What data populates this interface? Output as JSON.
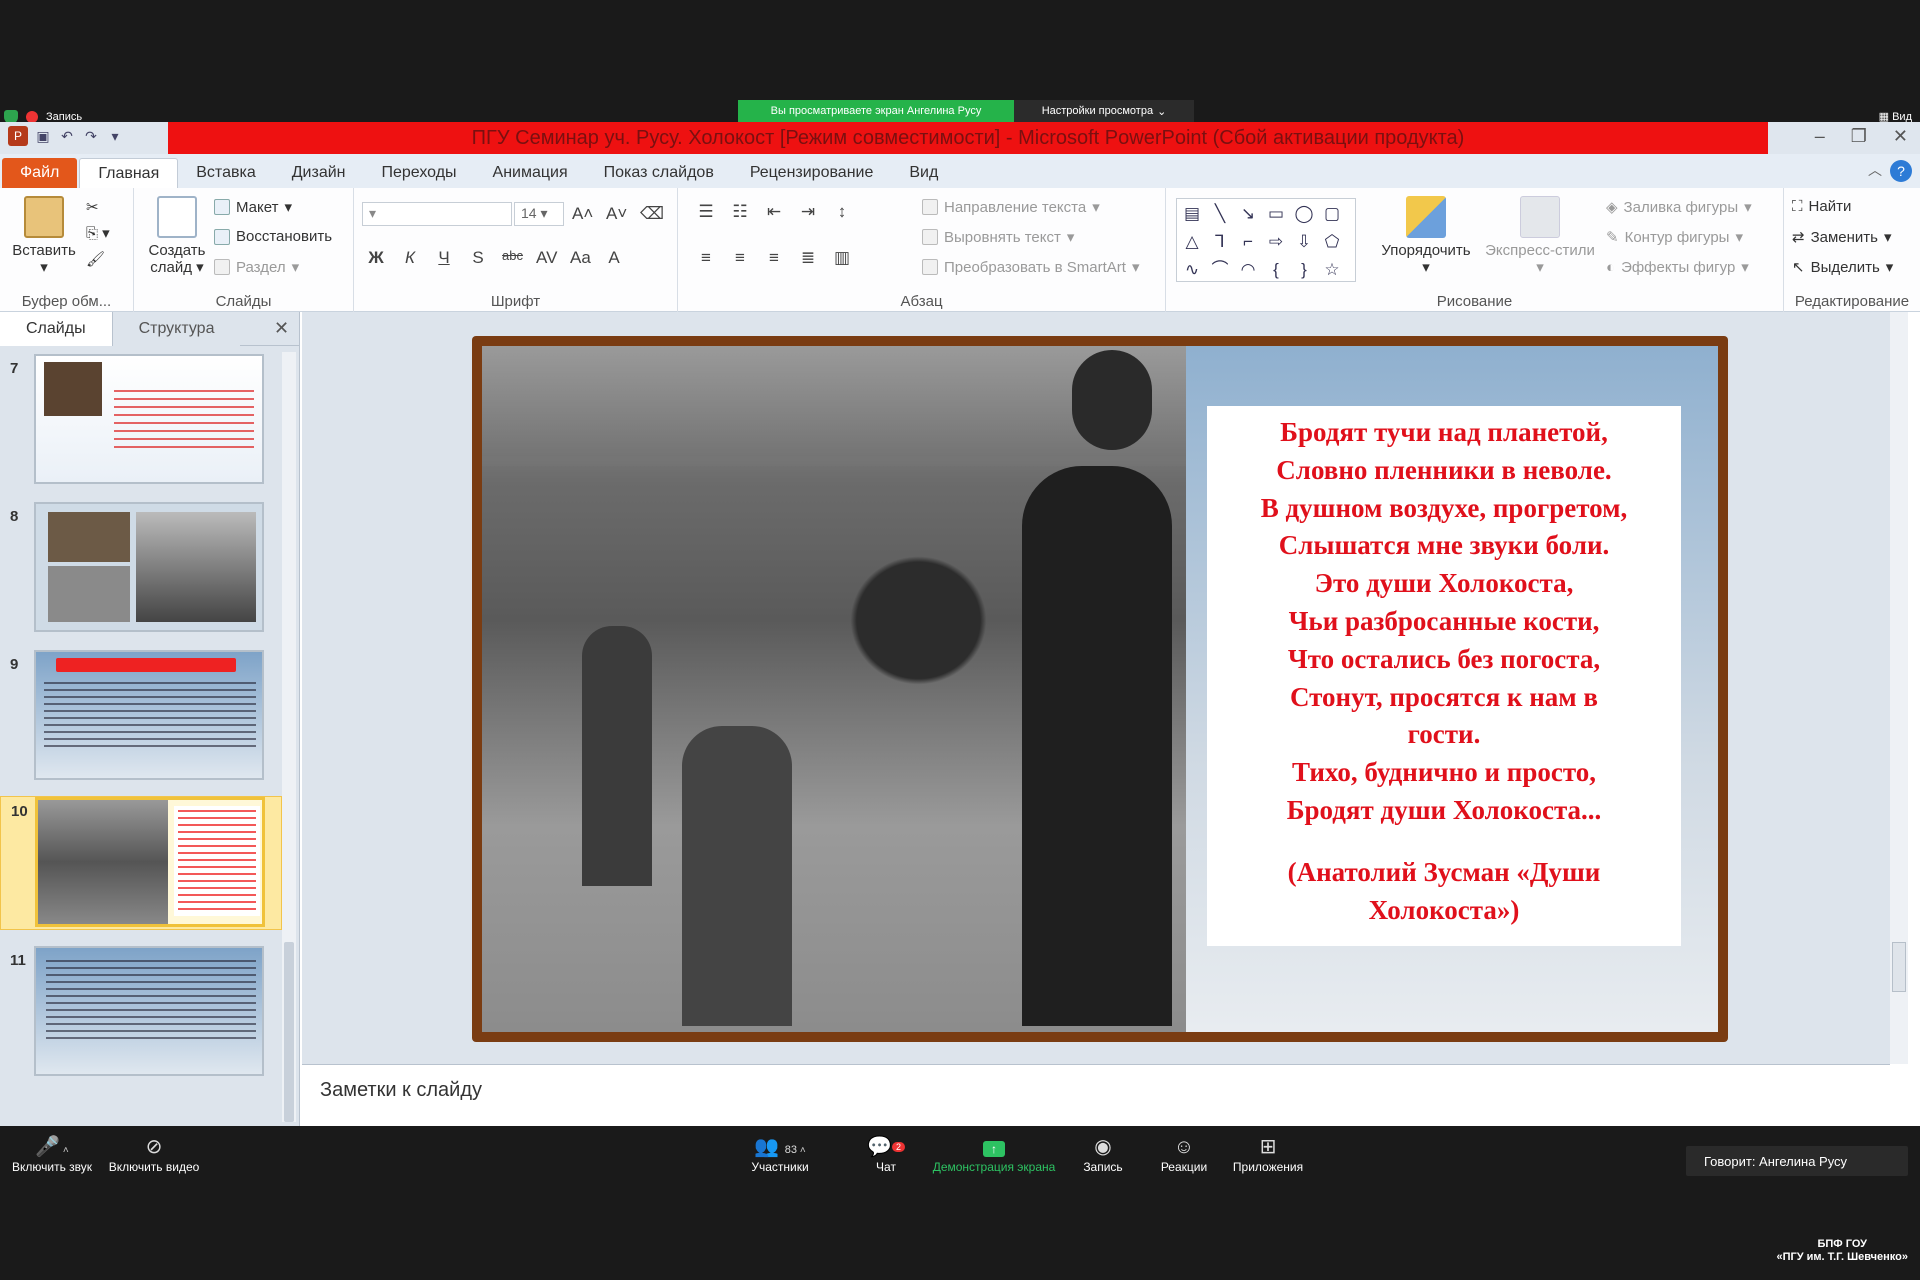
{
  "zoom": {
    "share_banner": "Вы просматриваете экран Ангелина Русу",
    "view_settings": "Настройки просмотра",
    "record_label": "Запись",
    "view_label": "Вид",
    "bottom": {
      "mute": "Включить звук",
      "video": "Включить видео",
      "participants": "Участники",
      "participants_count": "83",
      "chat": "Чат",
      "chat_badge": "2",
      "share": "Демонстрация экрана",
      "record": "Запись",
      "reactions": "Реакции",
      "apps": "Приложения"
    },
    "speaker": "Говорит: Ангелина Русу",
    "institution_line1": "БПФ ГОУ",
    "institution_line2": "«ПГУ им. Т.Г. Шевченко»"
  },
  "ppt": {
    "title": "ПГУ Семинар уч. Русу. Холокост [Режим совместимости]  -  Microsoft PowerPoint (Сбой активации продукта)",
    "tabs": [
      "Файл",
      "Главная",
      "Вставка",
      "Дизайн",
      "Переходы",
      "Анимация",
      "Показ слайдов",
      "Рецензирование",
      "Вид"
    ],
    "ribbon": {
      "clipboard": {
        "paste": "Вставить",
        "label": "Буфер обм..."
      },
      "slides": {
        "new_slide": "Создать слайд",
        "layout": "Макет",
        "reset": "Восстановить",
        "section": "Раздел",
        "label": "Слайды"
      },
      "font": {
        "size": "14",
        "label": "Шрифт"
      },
      "paragraph": {
        "text_direction": "Направление текста",
        "align_text": "Выровнять текст",
        "smartart": "Преобразовать в SmartArt",
        "label": "Абзац"
      },
      "drawing": {
        "arrange": "Упорядочить",
        "quick_styles": "Экспресс-стили",
        "fill": "Заливка фигуры",
        "outline": "Контур фигуры",
        "effects": "Эффекты фигур",
        "label": "Рисование"
      },
      "editing": {
        "find": "Найти",
        "replace": "Заменить",
        "select": "Выделить",
        "label": "Редактирование"
      }
    },
    "left_pane": {
      "tab_slides": "Слайды",
      "tab_outline": "Структура",
      "slide_numbers": [
        "7",
        "8",
        "9",
        "10",
        "11"
      ]
    },
    "slide": {
      "poem_lines": [
        "Бродят тучи над планетой,",
        "Словно пленники в неволе.",
        "В душном воздухе, прогретом,",
        "Слышатся мне звуки боли.",
        "Это души Холокоста,",
        "Чьи разбросанные кости,",
        "Что остались без погоста,",
        "Стонут, просятся к нам в",
        "гости.",
        "Тихо, буднично и просто,",
        "Бродят души Холокоста..."
      ],
      "attribution_1": "(Анатолий Зусман  «Души",
      "attribution_2": "Холокоста»)"
    },
    "notes_placeholder": "Заметки к слайду"
  }
}
